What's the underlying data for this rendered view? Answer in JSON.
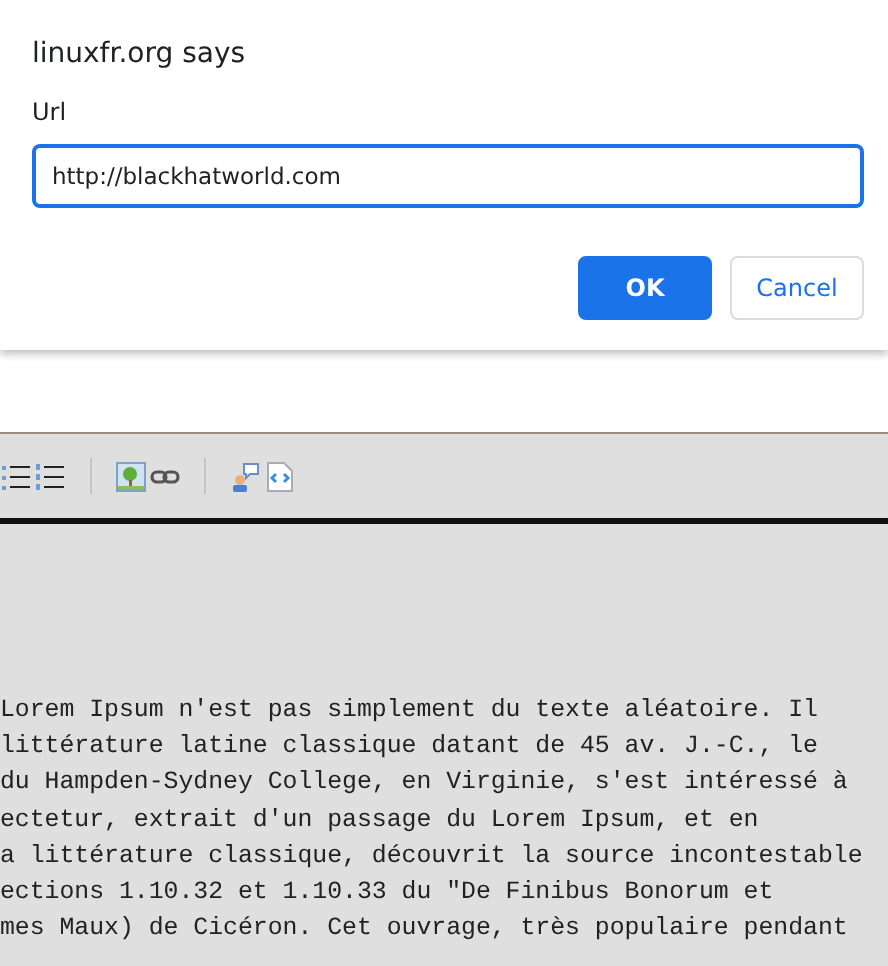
{
  "dialog": {
    "title": "linuxfr.org says",
    "label": "Url",
    "value": "http://blackhatworld.com",
    "buttons": [
      {
        "label": "OK",
        "kind": "primary"
      },
      {
        "label": "Cancel",
        "kind": "secondary"
      }
    ]
  },
  "editor": {
    "lines": [
      "Lorem Ipsum n'est pas simplement du texte aléatoire. Il",
      "littérature latine classique datant de 45 av. J.-C., le",
      "du Hampden-Sydney College, en Virginie, s'est intéressé à",
      "ectetur, extrait d'un passage du Lorem Ipsum, et en",
      "a littérature classique, découvrit la source incontestable",
      "ections 1.10.32 et 1.10.33 du \"De Finibus Bonorum et",
      "mes Maux) de Cicéron. Cet ouvrage, très populaire pendant"
    ]
  }
}
